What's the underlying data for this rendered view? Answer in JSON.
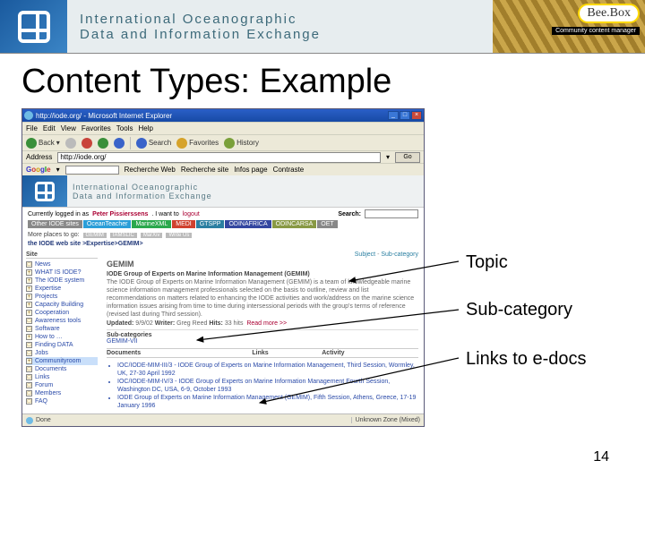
{
  "header": {
    "org_line1": "International Oceanographic",
    "org_line2": "Data and Information Exchange",
    "beebox_label": "Bee.Box",
    "beebox_sub": "Community content manager"
  },
  "slide": {
    "title": "Content Types: Example",
    "page_number": "14"
  },
  "callouts": {
    "topic": "Topic",
    "subcategory": "Sub-category",
    "links": "Links to e-docs"
  },
  "browser": {
    "window_title": "http://iode.org/ - Microsoft Internet Explorer",
    "menu": [
      "File",
      "Edit",
      "View",
      "Favorites",
      "Tools",
      "Help"
    ],
    "toolbar": {
      "back": "Back",
      "search": "Search",
      "favorites": "Favorites",
      "history": "History"
    },
    "address_label": "Address",
    "address_value": "http://iode.org/",
    "go_label": "Go",
    "google_label": "Google",
    "google_items": [
      "Recherche Web",
      "Recherche site",
      "Infos page",
      "Contraste"
    ]
  },
  "page": {
    "title_line1": "International Oceanographic",
    "title_line2": "Data and Information Exchange",
    "login_text_prefix": "Currently logged in as",
    "login_user": "Peter Pissierssens",
    "login_text_mid": ". I want to",
    "login_logout": "logout",
    "search_label": "Search:",
    "nav_tabs": [
      "Other IODE sites",
      "OceanTeacher",
      "MarineXML",
      "MEDI",
      "GTSPP",
      "ODINAFRICA",
      "ODINCARSA",
      "OET"
    ],
    "moreplaces_label": "More places to go:",
    "moreplaces_chips": [
      "GEMIM",
      "IAMSLIC",
      "MarXiv",
      "Write Us"
    ],
    "breadcrumb": "the IODE web site >Expertise>GEMIM>",
    "crumbs_subject": "Subject",
    "crumbs_subcat": "Sub-category",
    "topic_heading": "GEMIM",
    "topic_descr1": "IODE Group of Experts on Marine Information Management (GEMIM)",
    "topic_descr2": "The IODE Group of Experts on Marine Information Management (GEMIM) is a team of knowledgeable marine science information management professionals selected on the basis to outline, review and list recommendations on matters related to enhancing the IODE activities and work/address on the marine science information issues arising from time to time during intersessional periods with the group's terms of reference (revised last during Third session).",
    "updated_label": "Updated:",
    "updated_value": "9/9/02",
    "writer_label": "Writer:",
    "writer_value": "Greg Reed",
    "hits_label": "Hits:",
    "hits_value": "33 hits",
    "readmore": "Read more >>",
    "subcat_label": "Sub-categories",
    "subcat_link": "GEMIM-VII",
    "table_headers": [
      "Documents",
      "Links",
      "Activity"
    ],
    "docs": [
      "IOC/IODE-MIM-III/3 - IODE Group of Experts on Marine Information Management, Third Session, Wormley, UK, 27-30 April 1992",
      "IOC/IODE-MIM-IV/3 - IODE Group of Experts on Marine Information Management Fourth Session, Washington DC, USA, 6-9, October 1993",
      "IODE Group of Experts on Marine Information Management (GEMIM), Fifth Session, Athens, Greece, 17-19 January 1996"
    ],
    "sidebar_header": "Site",
    "sidebar": [
      "News",
      "WHAT IS IODE?",
      "The IODE system",
      "Expertise",
      "Projects",
      "Capacity Building",
      "Cooperation",
      "Awareness tools",
      "Software",
      "How to …",
      "Finding DATA",
      "Jobs",
      "Communityroom",
      "Documents",
      "Links",
      "Forum",
      "Members",
      "FAQ"
    ],
    "status_done": "Done",
    "status_zone": "Unknown Zone (Mixed)"
  }
}
